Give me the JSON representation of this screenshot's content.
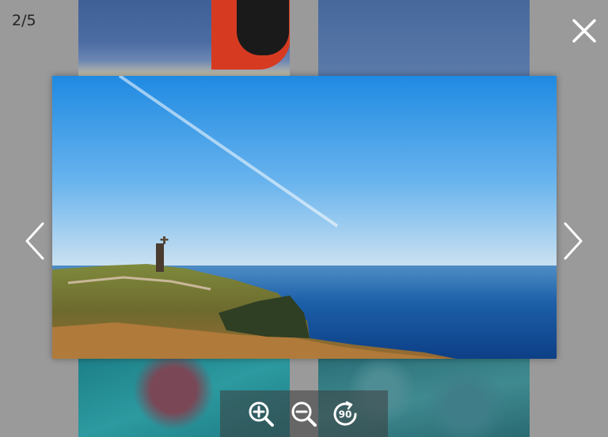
{
  "viewer": {
    "counter": "2/5",
    "rotate_label": "90"
  },
  "icons": {
    "close": "close-icon",
    "prev": "chevron-left-icon",
    "next": "chevron-right-icon",
    "zoom_in": "zoom-in-icon",
    "zoom_out": "zoom-out-icon",
    "rotate": "rotate-icon"
  },
  "colors": {
    "overlay": "#9a9a9a",
    "icon": "#ffffff",
    "toolbar": "#3c3c3c"
  }
}
